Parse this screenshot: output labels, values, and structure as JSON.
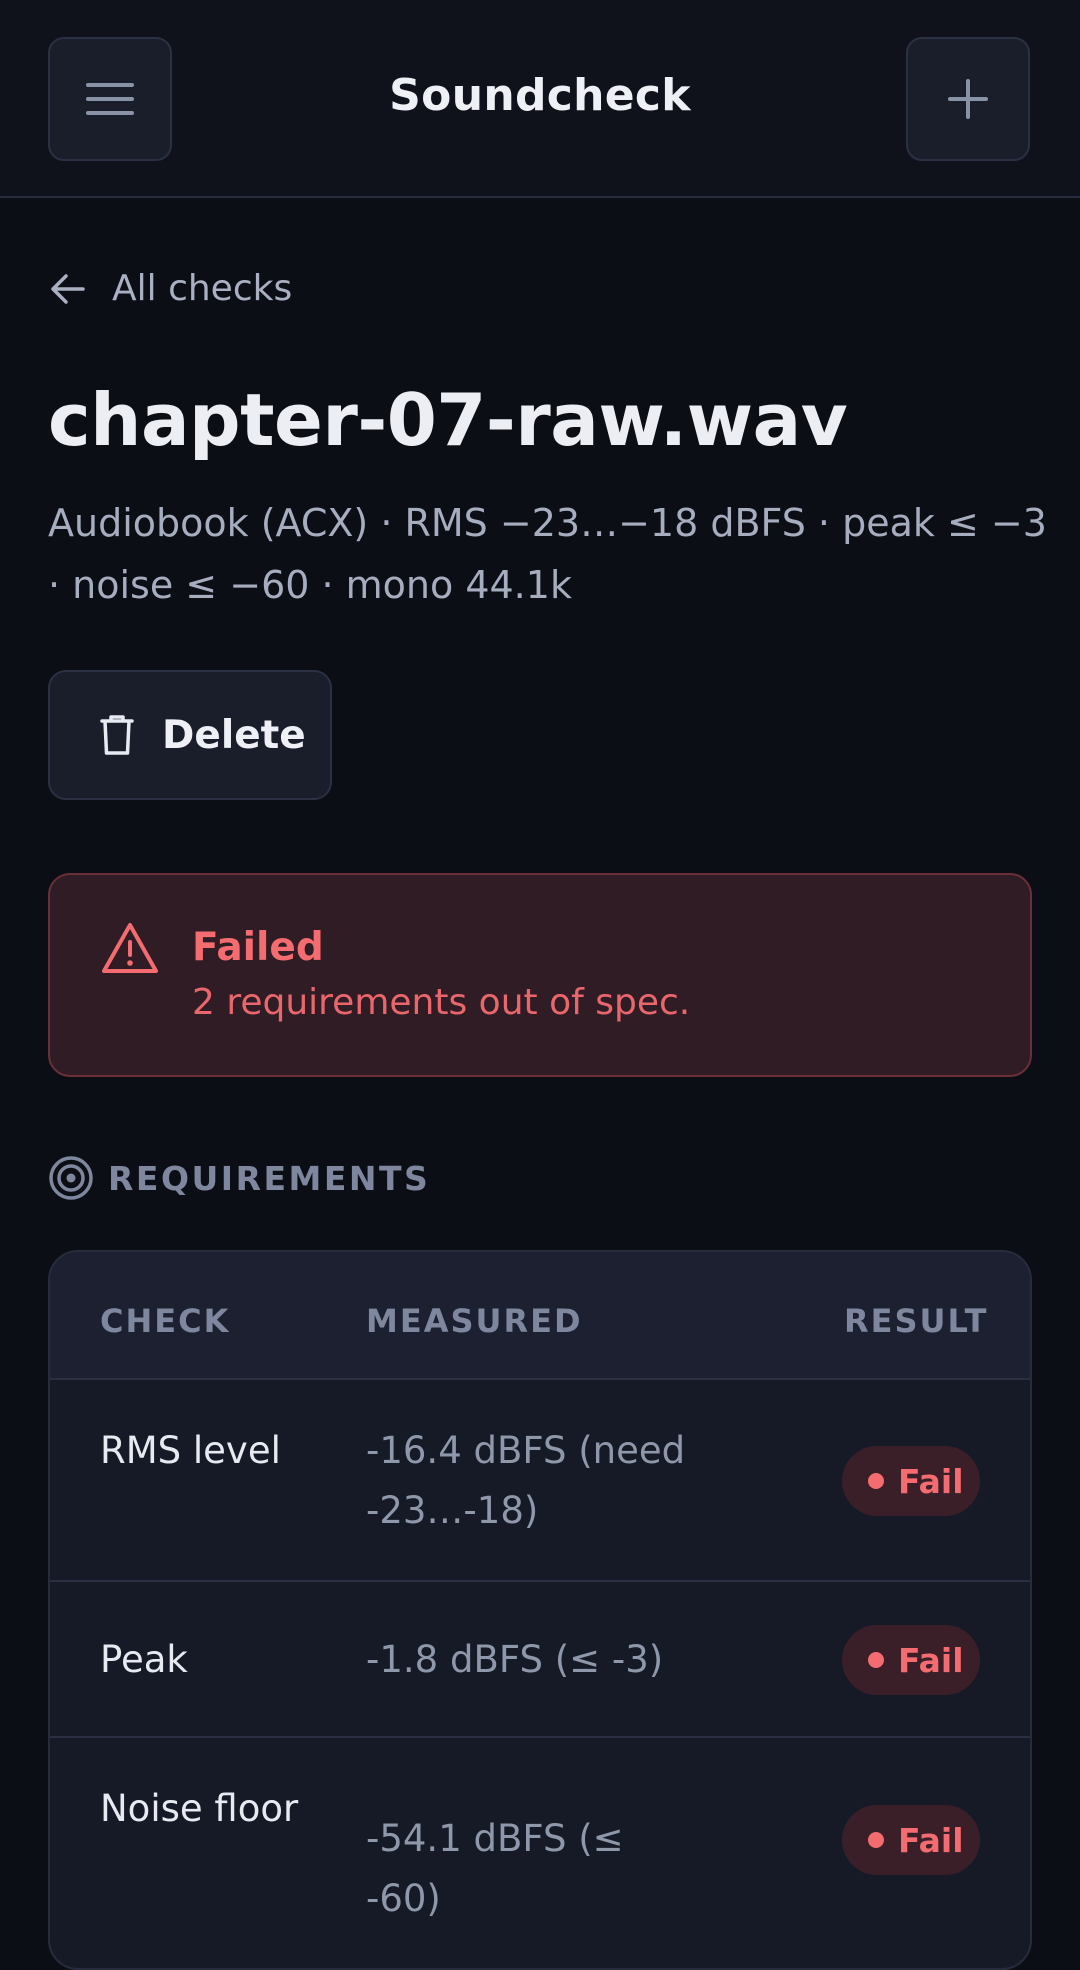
{
  "header": {
    "title": "Soundcheck",
    "menu_icon": "hamburger-menu-icon",
    "add_icon": "plus-icon"
  },
  "back": {
    "label": "All checks",
    "icon": "arrow-left-icon"
  },
  "file": {
    "name": "chapter-07-raw.wav",
    "meta": "Audiobook (ACX) · RMS −23…−18 dBFS · peak ≤ −3 · noise ≤ −60 · mono 44.1k"
  },
  "actions": {
    "delete_label": "Delete",
    "delete_icon": "trash-icon"
  },
  "alert": {
    "icon": "warning-triangle-icon",
    "title": "Failed",
    "message": "2 requirements out of spec."
  },
  "requirements": {
    "heading": "REQUIREMENTS",
    "heading_icon": "target-icon",
    "columns": [
      "CHECK",
      "MEASURED",
      "RESULT"
    ],
    "rows": [
      {
        "check": "RMS level",
        "measured": "-16.4 dBFS (need -23…-18)",
        "result": "Fail"
      },
      {
        "check": "Peak",
        "measured": "-1.8 dBFS (≤ -3)",
        "result": "Fail"
      },
      {
        "check": "Noise floor",
        "measured": "-54.1 dBFS (≤ -60)",
        "result": "Fail"
      }
    ]
  },
  "colors": {
    "background": "#0c0e15",
    "danger": "#f46c70",
    "muted": "#7e879d"
  }
}
